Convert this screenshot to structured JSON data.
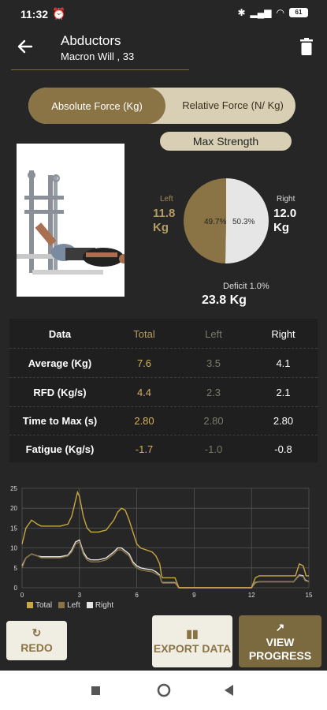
{
  "status": {
    "time": "11:32",
    "battery": "61"
  },
  "header": {
    "title": "Abductors",
    "subtitle": "Macron Will , 33"
  },
  "toggle": {
    "active": "Absolute Force (Kg)",
    "inactive": "Relative Force (N/ Kg)"
  },
  "mode": "Max Strength",
  "pie": {
    "left_label": "Left",
    "left_value": "11.8",
    "left_unit": "Kg",
    "right_label": "Right",
    "right_value": "12.0",
    "right_unit": "Kg",
    "left_pct": "49.7%",
    "right_pct": "50.3%",
    "left_share": 0.497,
    "deficit": "Deficit 1.0%",
    "total": "23.8 Kg",
    "colors": {
      "left": "#8a7445",
      "right": "#e6e6e6"
    }
  },
  "table": {
    "headers": [
      "Data",
      "Total",
      "Left",
      "Right"
    ],
    "rows": [
      [
        "Average (Kg)",
        "7.6",
        "3.5",
        "4.1"
      ],
      [
        "RFD (Kg/s)",
        "4.4",
        "2.3",
        "2.1"
      ],
      [
        "Time to Max (s)",
        "2.80",
        "2.80",
        "2.80"
      ],
      [
        "Fatigue (Kg/s)",
        "-1.7",
        "-1.0",
        "-0.8"
      ]
    ]
  },
  "chart_data": {
    "type": "line",
    "xlim": [
      0,
      15
    ],
    "ylim": [
      0,
      25
    ],
    "xticks": [
      "0",
      "3",
      "6",
      "9",
      "12",
      "15"
    ],
    "yticks": [
      "0",
      "5",
      "10",
      "15",
      "20",
      "25"
    ],
    "series": [
      {
        "name": "Total",
        "color": "#c9a83f",
        "x": [
          0,
          0.2,
          0.5,
          0.8,
          1,
          1.5,
          2,
          2.4,
          2.6,
          2.8,
          2.9,
          3.0,
          3.2,
          3.4,
          3.6,
          4,
          4.4,
          4.8,
          5.0,
          5.2,
          5.4,
          5.6,
          5.8,
          6.0,
          6.2,
          6.5,
          6.8,
          7.0,
          7.2,
          7.3,
          7.35,
          7.4,
          8.0,
          8.2,
          9,
          10,
          11,
          12,
          12.2,
          12.4,
          13,
          14,
          14.2,
          14.3,
          14.5,
          14.7,
          14.8,
          14.85,
          15
        ],
        "y": [
          11,
          15,
          17,
          16,
          15.5,
          15.5,
          15.5,
          16,
          18,
          22,
          24,
          23,
          18,
          15,
          14,
          14,
          14.5,
          17,
          19,
          20,
          19.5,
          17,
          14,
          11,
          10,
          9.5,
          9,
          8,
          6,
          3,
          2.5,
          2.5,
          2.5,
          0,
          0,
          0,
          0,
          0,
          2.5,
          3,
          3,
          3,
          3,
          3,
          6,
          5.5,
          4,
          3,
          3
        ]
      },
      {
        "name": "Left",
        "color": "#8a7445",
        "x": [
          0,
          0.2,
          0.5,
          0.8,
          1,
          1.5,
          2,
          2.4,
          2.6,
          2.8,
          3.0,
          3.2,
          3.4,
          3.6,
          4,
          4.4,
          4.8,
          5.0,
          5.2,
          5.6,
          5.8,
          6.0,
          6.2,
          6.5,
          6.8,
          7.0,
          7.2,
          7.3,
          7.35,
          7.4,
          8.0,
          8.2,
          9,
          12,
          12.2,
          12.4,
          14.2,
          14.5,
          14.7,
          14.8,
          15
        ],
        "y": [
          5,
          7.5,
          8.5,
          8,
          7.5,
          7.5,
          7.5,
          8,
          9,
          11,
          11.5,
          8.5,
          7,
          6.5,
          6.5,
          7,
          8.5,
          9.5,
          9.5,
          8,
          6,
          5,
          4.5,
          4.2,
          4,
          3.5,
          3,
          1.5,
          1.2,
          1.2,
          1.2,
          0,
          0,
          0,
          1.2,
          1.5,
          1.5,
          3,
          2.8,
          1.8,
          1.5
        ]
      },
      {
        "name": "Right",
        "color": "#e6e6e6",
        "x": [
          0,
          0.2,
          0.5,
          0.8,
          1,
          1.5,
          2,
          2.4,
          2.6,
          2.8,
          3.0,
          3.2,
          3.4,
          3.6,
          4,
          4.4,
          4.8,
          5.0,
          5.2,
          5.6,
          5.8,
          6.0,
          6.2,
          6.5,
          6.8,
          7.0,
          7.2,
          7.3,
          7.35,
          7.4,
          8.0,
          8.2,
          9,
          12,
          12.2,
          12.4,
          14.2,
          14.5,
          14.7,
          14.8,
          15
        ],
        "y": [
          5.5,
          7.5,
          8.5,
          8,
          7.8,
          7.8,
          7.8,
          8.2,
          9.5,
          11.5,
          12,
          9,
          7.5,
          7,
          7,
          7.5,
          9,
          10,
          10,
          8.5,
          6.5,
          5.5,
          5,
          4.7,
          4.5,
          4,
          3.2,
          1.5,
          1.3,
          1.3,
          1.3,
          0,
          0,
          0,
          1.3,
          1.5,
          1.5,
          3.2,
          3,
          2,
          1.5
        ]
      }
    ],
    "legend": [
      "Total",
      "Left",
      "Right"
    ],
    "grid": true
  },
  "buttons": {
    "redo": "REDO",
    "export": "EXPORT DATA",
    "progress": "VIEW PROGRESS"
  }
}
